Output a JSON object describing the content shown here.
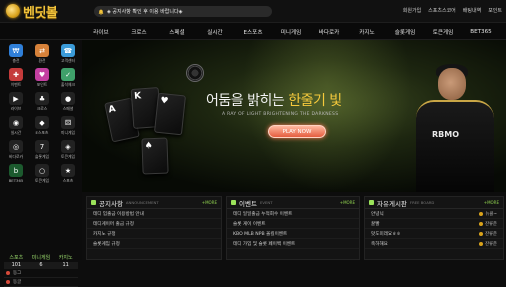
{
  "brand": {
    "logo_text": "벤딧볼",
    "accent": "#f0c23b"
  },
  "notice_bar": {
    "text": "◈ 공지사항 확인 후 이용 바랍니다◈"
  },
  "top_links": [
    "회원가입",
    "스포츠스코어",
    "배팅내역",
    "포인트"
  ],
  "nav": [
    "라이브",
    "크로스",
    "스페셜",
    "실시간",
    "E스포츠",
    "미니게임",
    "바다로카",
    "카지노",
    "슬롯게임",
    "토큰게임",
    "BET365"
  ],
  "sidebar": {
    "tiles": [
      {
        "label": "충전",
        "color": "#2f7fd9",
        "icon": "coin-icon"
      },
      {
        "label": "환전",
        "color": "#d6813a",
        "icon": "exchange-icon"
      },
      {
        "label": "고객센터",
        "color": "#3b9bd9",
        "icon": "headset-icon"
      },
      {
        "label": "이벤트",
        "color": "#c53b3b",
        "icon": "gift-icon"
      },
      {
        "label": "포인트",
        "color": "#c33fa0",
        "icon": "heart-icon"
      },
      {
        "label": "출석체크",
        "color": "#3fa06a",
        "icon": "check-icon"
      },
      {
        "label": "라이브",
        "color": "#222",
        "icon": "live-icon"
      },
      {
        "label": "크로스",
        "color": "#222",
        "icon": "cards-icon"
      },
      {
        "label": "스페셜",
        "color": "#222",
        "icon": "basketball-icon"
      },
      {
        "label": "실시간",
        "color": "#222",
        "icon": "soccer-icon"
      },
      {
        "label": "E스포츠",
        "color": "#222",
        "icon": "esports-icon"
      },
      {
        "label": "미니게임",
        "color": "#222",
        "icon": "dice-icon"
      },
      {
        "label": "바다로카",
        "color": "#222",
        "icon": "chip-icon"
      },
      {
        "label": "슬롯게임",
        "color": "#222",
        "icon": "slot-icon"
      },
      {
        "label": "토큰게임",
        "color": "#222",
        "icon": "token-icon"
      },
      {
        "label": "BET365",
        "color": "#1c5a2e",
        "icon": "bet365-icon"
      },
      {
        "label": "토큰게임",
        "color": "#222",
        "icon": "ball-icon"
      },
      {
        "label": "스포츠",
        "color": "#222",
        "icon": "trophy-icon"
      }
    ],
    "scores": {
      "headers": [
        "스포츠",
        "미니게임",
        "카지노"
      ],
      "values": [
        "101",
        "6",
        "11"
      ],
      "rows": [
        "동그",
        "동글"
      ]
    }
  },
  "hero": {
    "headline_pre": "어둠을 밝히는 ",
    "headline_hl": "한줄기 빛",
    "subtitle": "A RAY OF LIGHT BRIGHTENING THE DARKNESS",
    "button": "PLAY NOW",
    "jersey": "RBMO"
  },
  "panels": [
    {
      "title": "공지사항",
      "eng": "ANNOUNCEMENT",
      "more": "+MORE",
      "items": [
        "테디 입출금 이용방법 안내",
        "테디게이머 출금 규정",
        "카지노 규정",
        "슬롯게임 규정"
      ]
    },
    {
      "title": "이벤트",
      "eng": "EVENT",
      "more": "+MORE",
      "items": [
        "테디 일일출금 누적회수 이벤트",
        "슬롯 게이 이벤트",
        "KBO MLB NPB 올킬이벤트",
        "테디 가입 및 슬롯 페이백 이벤트"
      ]
    },
    {
      "title": "자유게시판",
      "eng": "FREE BOARD",
      "more": "+MORE",
      "items": [
        {
          "t": "안녕닉",
          "u": "뉴클~"
        },
        {
          "t": "꿀빨",
          "u": "잔류준"
        },
        {
          "t": "맛도미래요ㅎㅎ",
          "u": "잔류준"
        },
        {
          "t": "축하해요",
          "u": "잔류준"
        }
      ]
    }
  ]
}
